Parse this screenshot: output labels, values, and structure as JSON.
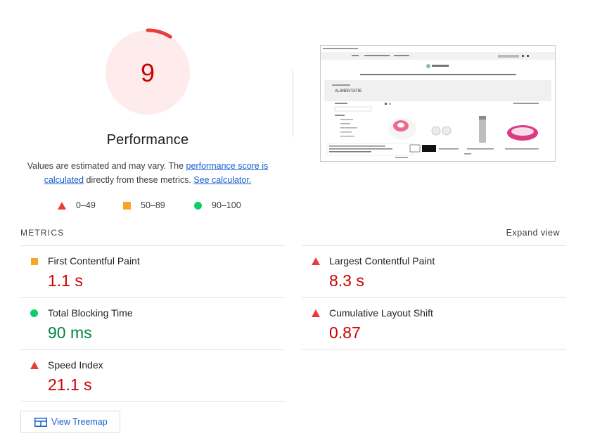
{
  "gauge": {
    "score": "9",
    "score_fraction": 0.09,
    "title": "Performance"
  },
  "description": {
    "text_1": "Values are estimated and may vary. The ",
    "link_score": "performance score is calculated",
    "text_2": " directly from these metrics. ",
    "link_calc": "See calculator."
  },
  "legend": [
    {
      "range": "0–49",
      "icon": "triangle-red"
    },
    {
      "range": "50–89",
      "icon": "square-orange"
    },
    {
      "range": "90–100",
      "icon": "circle-green"
    }
  ],
  "metrics_header": {
    "label": "METRICS",
    "expand": "Expand view"
  },
  "metrics": [
    {
      "name": "First Contentful Paint",
      "value": "1.1 s",
      "rating": "average"
    },
    {
      "name": "Largest Contentful Paint",
      "value": "8.3 s",
      "rating": "fail"
    },
    {
      "name": "Total Blocking Time",
      "value": "90 ms",
      "rating": "pass"
    },
    {
      "name": "Cumulative Layout Shift",
      "value": "0.87",
      "rating": "fail"
    },
    {
      "name": "Speed Index",
      "value": "21.1 s",
      "rating": "fail"
    }
  ],
  "treemap": {
    "label": "View Treemap",
    "icon": "treemap-icon"
  },
  "screenshot": {
    "page_heading": "ALIMENTATIE"
  },
  "colors": {
    "fail": "#cc0000",
    "fail_icon": "#eb3b3b",
    "average": "#f5a623",
    "pass": "#018642",
    "pass_icon": "#0cce6b",
    "link": "#1a5fd0"
  }
}
